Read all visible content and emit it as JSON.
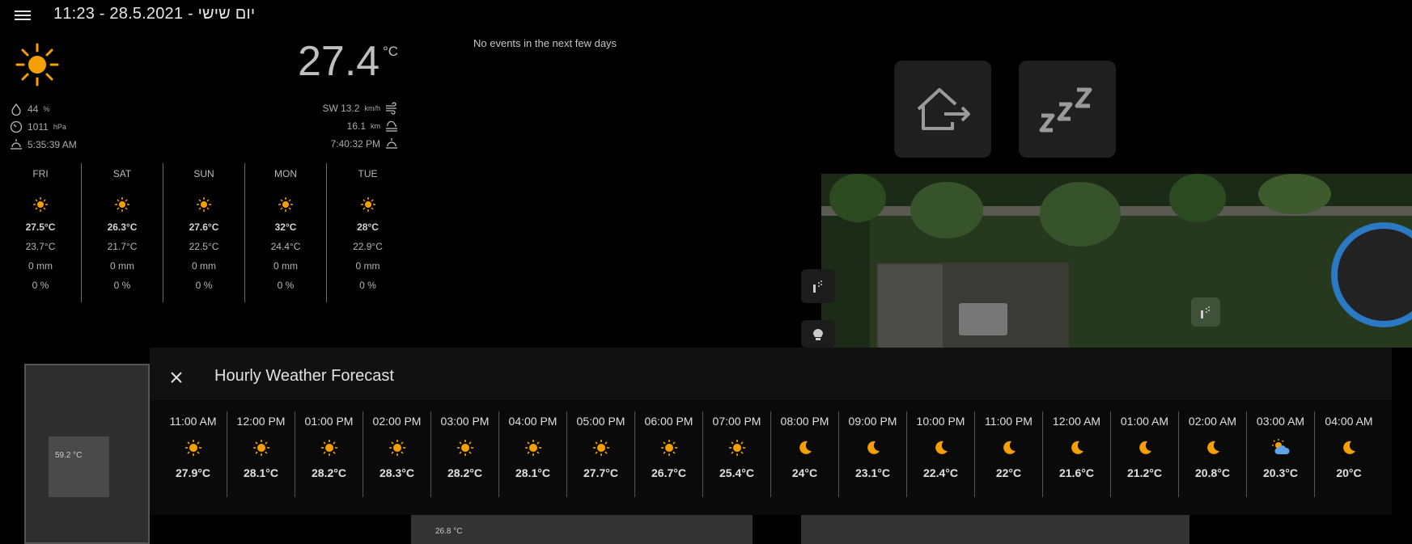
{
  "header": {
    "title": "11:23 - 28.5.2021 - יום שישי",
    "menu_icon": "menu-icon"
  },
  "weather": {
    "condition_icon": "sun-icon",
    "temperature": "27.4",
    "unit": "°C",
    "humidity": "44",
    "humidity_unit": "%",
    "pressure": "1011",
    "pressure_unit": "hPa",
    "sunrise": "5:35:39 AM",
    "wind": "SW 13.2",
    "wind_unit": "km/h",
    "visibility": "16.1",
    "visibility_unit": "km",
    "sunset": "7:40:32 PM",
    "forecast": [
      {
        "day": "FRI",
        "icon": "sun-icon",
        "high": "27.5°C",
        "low": "23.7°C",
        "precip": "0 mm",
        "prob": "0 %"
      },
      {
        "day": "SAT",
        "icon": "sun-icon",
        "high": "26.3°C",
        "low": "21.7°C",
        "precip": "0 mm",
        "prob": "0 %"
      },
      {
        "day": "SUN",
        "icon": "sun-icon",
        "high": "27.6°C",
        "low": "22.5°C",
        "precip": "0 mm",
        "prob": "0 %"
      },
      {
        "day": "MON",
        "icon": "sun-icon",
        "high": "32°C",
        "low": "24.4°C",
        "precip": "0 mm",
        "prob": "0 %"
      },
      {
        "day": "TUE",
        "icon": "sun-icon",
        "high": "28°C",
        "low": "22.9°C",
        "precip": "0 mm",
        "prob": "0 %"
      }
    ]
  },
  "calendar": {
    "empty_text": "No events in the next few days"
  },
  "scenes": {
    "leave_home_icon": "home-export-icon",
    "sleep_icon": "sleep-icon"
  },
  "floorplan": {
    "room_temp_1": "59.2 °C",
    "room_temp_2": "26.8 °C"
  },
  "dialog": {
    "title": "Hourly Weather Forecast",
    "close_icon": "close-icon",
    "hours": [
      {
        "time": "11:00 AM",
        "icon": "sun-icon",
        "temp": "27.9°C"
      },
      {
        "time": "12:00 PM",
        "icon": "sun-icon",
        "temp": "28.1°C"
      },
      {
        "time": "01:00 PM",
        "icon": "sun-icon",
        "temp": "28.2°C"
      },
      {
        "time": "02:00 PM",
        "icon": "sun-icon",
        "temp": "28.3°C"
      },
      {
        "time": "03:00 PM",
        "icon": "sun-icon",
        "temp": "28.2°C"
      },
      {
        "time": "04:00 PM",
        "icon": "sun-icon",
        "temp": "28.1°C"
      },
      {
        "time": "05:00 PM",
        "icon": "sun-icon",
        "temp": "27.7°C"
      },
      {
        "time": "06:00 PM",
        "icon": "sun-icon",
        "temp": "26.7°C"
      },
      {
        "time": "07:00 PM",
        "icon": "sun-icon",
        "temp": "25.4°C"
      },
      {
        "time": "08:00 PM",
        "icon": "moon-icon",
        "temp": "24°C"
      },
      {
        "time": "09:00 PM",
        "icon": "moon-icon",
        "temp": "23.1°C"
      },
      {
        "time": "10:00 PM",
        "icon": "moon-icon",
        "temp": "22.4°C"
      },
      {
        "time": "11:00 PM",
        "icon": "moon-icon",
        "temp": "22°C"
      },
      {
        "time": "12:00 AM",
        "icon": "moon-icon",
        "temp": "21.6°C"
      },
      {
        "time": "01:00 AM",
        "icon": "moon-icon",
        "temp": "21.2°C"
      },
      {
        "time": "02:00 AM",
        "icon": "moon-icon",
        "temp": "20.8°C"
      },
      {
        "time": "03:00 AM",
        "icon": "partly-cloudy-icon",
        "temp": "20.3°C"
      },
      {
        "time": "04:00 AM",
        "icon": "moon-icon",
        "temp": "20°C"
      }
    ]
  },
  "colors": {
    "sun": "#f5a000",
    "moon": "#f5a000",
    "cloud": "#5fa4e6",
    "background": "#000000",
    "card": "#1f1f1f",
    "dialog": "#111111"
  }
}
